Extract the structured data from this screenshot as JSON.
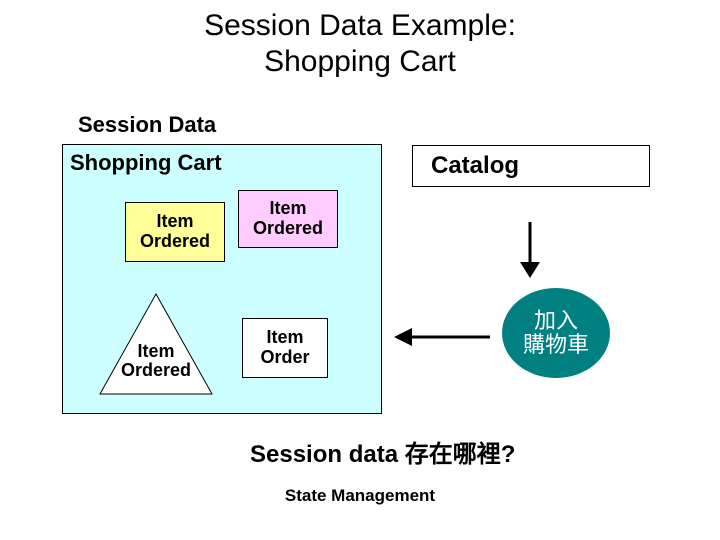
{
  "title_line1": "Session Data Example:",
  "title_line2": "Shopping Cart",
  "session_label": "Session Data",
  "cart_label": "Shopping Cart",
  "item1_line1": "Item",
  "item1_line2": "Ordered",
  "item2_line1": "Item",
  "item2_line2": "Ordered",
  "item3_line1": "Item",
  "item3_line2": "Ordered",
  "item4_line1": "Item",
  "item4_line2": "Order",
  "catalog_label": "Catalog",
  "circle_line1": "加入",
  "circle_line2": "購物車",
  "question": "Session data 存在哪裡?",
  "footer": "State Management",
  "colors": {
    "session_bg": "#ccffff",
    "item_yellow": "#ffff99",
    "item_pink": "#ffccff",
    "circle_bg": "#008080"
  }
}
